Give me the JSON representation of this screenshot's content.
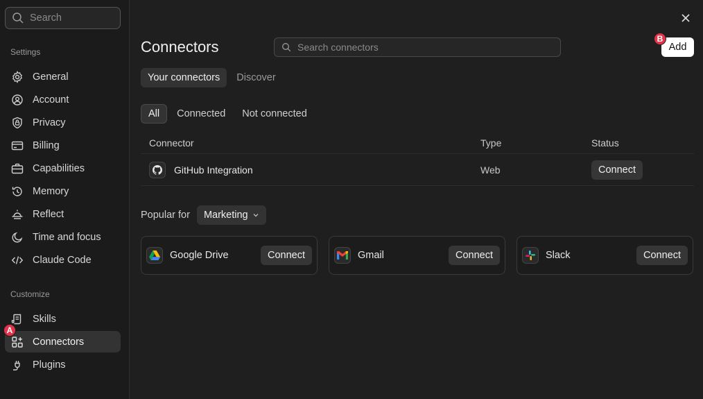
{
  "sidebar": {
    "search_placeholder": "Search",
    "settings_label": "Settings",
    "settings_items": [
      {
        "label": "General",
        "icon": "gear-icon"
      },
      {
        "label": "Account",
        "icon": "user-circle-icon"
      },
      {
        "label": "Privacy",
        "icon": "shield-lock-icon"
      },
      {
        "label": "Billing",
        "icon": "credit-card-icon"
      },
      {
        "label": "Capabilities",
        "icon": "briefcase-icon"
      },
      {
        "label": "Memory",
        "icon": "history-icon"
      },
      {
        "label": "Reflect",
        "icon": "sunrise-icon"
      },
      {
        "label": "Time and focus",
        "icon": "moon-icon"
      },
      {
        "label": "Claude Code",
        "icon": "code-icon"
      }
    ],
    "customize_label": "Customize",
    "customize_items": [
      {
        "label": "Skills",
        "icon": "scroll-icon"
      },
      {
        "label": "Connectors",
        "icon": "grid-plus-icon",
        "active": true
      },
      {
        "label": "Plugins",
        "icon": "plug-icon"
      }
    ],
    "badge_a": "A"
  },
  "main": {
    "title": "Connectors",
    "search_placeholder": "Search connectors",
    "add_label": "Add",
    "badge_b": "B",
    "tabs": [
      "Your connectors",
      "Discover"
    ],
    "filters": [
      "All",
      "Connected",
      "Not connected"
    ],
    "table": {
      "headers": [
        "Connector",
        "Type",
        "Status"
      ],
      "rows": [
        {
          "name": "GitHub Integration",
          "type": "Web",
          "status_action": "Connect",
          "icon": "github-icon"
        }
      ]
    },
    "popular": {
      "label": "Popular for",
      "selected": "Marketing",
      "cards": [
        {
          "name": "Google Drive",
          "action": "Connect",
          "icon": "google-drive-icon"
        },
        {
          "name": "Gmail",
          "action": "Connect",
          "icon": "gmail-icon"
        },
        {
          "name": "Slack",
          "action": "Connect",
          "icon": "slack-icon"
        }
      ]
    }
  },
  "colors": {
    "background": "#1f1f1f",
    "sidebar": "#1b1b1b",
    "active_item": "#333333",
    "badge": "#e0344b",
    "add_button": "#ffffff"
  }
}
